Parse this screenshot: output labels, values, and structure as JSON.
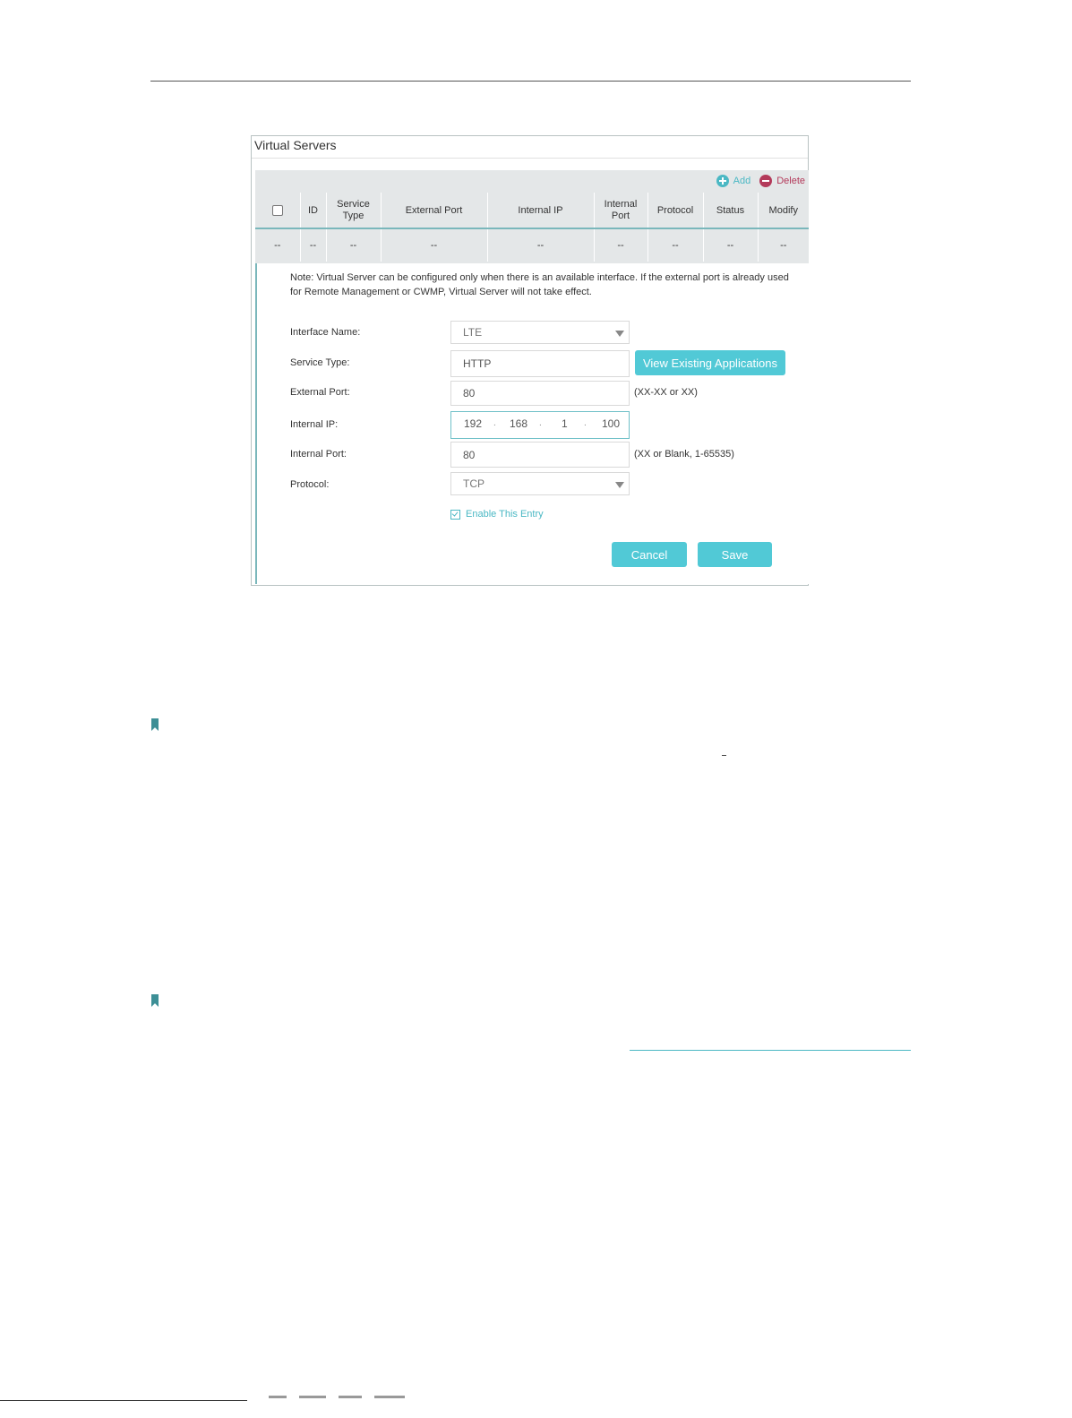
{
  "panel": {
    "title": "Virtual Servers",
    "toolbar": {
      "add_label": "Add",
      "delete_label": "Delete"
    },
    "table": {
      "columns": [
        "ID",
        "Service Type",
        "External Port",
        "Internal IP",
        "Internal Port",
        "Protocol",
        "Status",
        "Modify"
      ],
      "row": [
        "--",
        "--",
        "--",
        "--",
        "--",
        "--",
        "--",
        "--",
        "--"
      ]
    },
    "note": "Note: Virtual Server can be configured only when there is an available interface. If the external port is already used for Remote Management or CWMP, Virtual Server will not take effect.",
    "form": {
      "interface_name": {
        "label": "Interface Name:",
        "value": "LTE"
      },
      "service_type": {
        "label": "Service Type:",
        "value": "HTTP",
        "button": "View Existing Applications"
      },
      "external_port": {
        "label": "External Port:",
        "value": "80",
        "hint": "(XX-XX or XX)"
      },
      "internal_ip": {
        "label": "Internal IP:",
        "octets": [
          "192",
          "168",
          "1",
          "100"
        ]
      },
      "internal_port": {
        "label": "Internal Port:",
        "value": "80",
        "hint": "(XX or Blank, 1-65535)"
      },
      "protocol": {
        "label": "Protocol:",
        "value": "TCP"
      },
      "enable_label": "Enable This Entry",
      "enable_checked": true
    },
    "buttons": {
      "cancel": "Cancel",
      "save": "Save"
    }
  },
  "colors": {
    "accent": "#51c9d6",
    "delete": "#b33a5a",
    "bookmark": "#3d8f96"
  }
}
